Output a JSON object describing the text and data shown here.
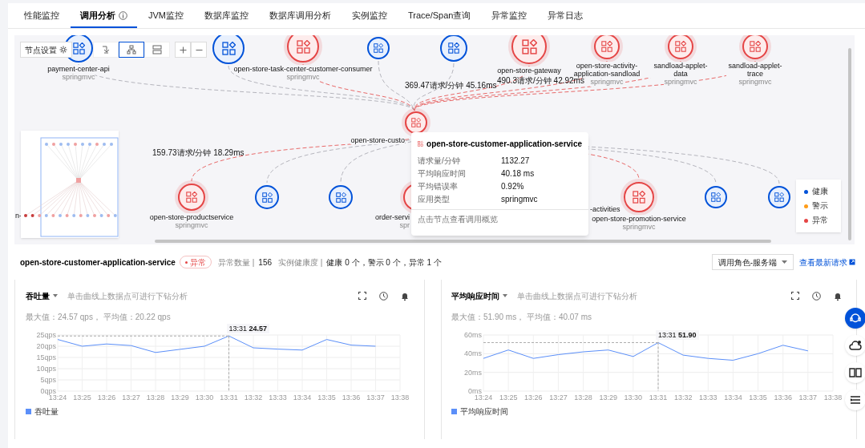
{
  "tabs": [
    {
      "label": "性能监控",
      "selected": false,
      "info": false
    },
    {
      "label": "调用分析",
      "selected": true,
      "info": true
    },
    {
      "label": "JVM监控",
      "selected": false,
      "info": false
    },
    {
      "label": "数据库监控",
      "selected": false,
      "info": false
    },
    {
      "label": "数据库调用分析",
      "selected": false,
      "info": false
    },
    {
      "label": "实例监控",
      "selected": false,
      "info": false
    },
    {
      "label": "Trace/Span查询",
      "selected": false,
      "info": false
    },
    {
      "label": "异常监控",
      "selected": false,
      "info": false
    },
    {
      "label": "异常日志",
      "selected": false,
      "info": false
    }
  ],
  "topology": {
    "toolbar": {
      "settings_label": "节点设置",
      "layouts": [
        {
          "selected": false
        },
        {
          "selected": true
        },
        {
          "selected": false
        }
      ]
    },
    "nodes": [
      {
        "abnormal": false,
        "label": "payment-center-api",
        "sub": "springmvc"
      },
      {
        "abnormal": false
      },
      {
        "abnormal": true,
        "label": "open-store-task-center-customer-consumer",
        "sub": "springmvc"
      },
      {
        "abnormal": false
      },
      {
        "abnormal": false
      },
      {
        "abnormal": true,
        "label": "open-store-gateway"
      },
      {
        "abnormal": true,
        "label": "open-store-activity-application-sandload",
        "sub": "springmvc"
      },
      {
        "abnormal": true,
        "label": "sandload-applet-data",
        "sub": "springmvc"
      },
      {
        "abnormal": true,
        "label": "sandload-applet-trace",
        "sub": "springmvc"
      },
      {
        "abnormal": true,
        "label": "open-store-custo"
      },
      {
        "abnormal": true,
        "label": "open-store-productservice",
        "sub": "springmvc"
      },
      {
        "abnormal": false
      },
      {
        "abnormal": false
      },
      {
        "abnormal": true,
        "label": "order-servi",
        "sub": "spr"
      },
      {
        "abnormal": true,
        "label": "open-store-promotion-service",
        "sub": "springmvc"
      },
      {
        "abnormal": false
      },
      {
        "abnormal": false
      }
    ],
    "edge_labels": [
      "369.47请求/分钟 45.16ms",
      "490.3请求/分钟 42.92ms",
      "159.73请求/分钟 18.29ms"
    ],
    "cut_labels": [
      "n-",
      "-activities"
    ],
    "legend": [
      {
        "label": "健康",
        "color": "#0052d9"
      },
      {
        "label": "警示",
        "color": "#ff9c19"
      },
      {
        "label": "异常",
        "color": "#e54545"
      }
    ],
    "tooltip": {
      "title": "open-store-customer-application-service",
      "rows": [
        {
          "label": "请求量/分钟",
          "value": "1132.27"
        },
        {
          "label": "平均响应时间",
          "value": "40.18 ms"
        },
        {
          "label": "平均错误率",
          "value": "0.92%"
        },
        {
          "label": "应用类型",
          "value": "springmvc"
        }
      ],
      "footer": "点击节点查看调用概览"
    }
  },
  "summary": {
    "title": "open-store-customer-application-service",
    "badge": "异常",
    "stats": [
      {
        "label": "异常数量 |",
        "value": "156"
      },
      {
        "label": "实例健康度 |",
        "value": "健康 0 个，警示 0 个，异常 1 个"
      }
    ],
    "role_select": "调用角色-服务端",
    "link": "查看最新请求"
  },
  "charts": [
    {
      "metric": "吞吐量",
      "hint": "单击曲线上数据点可进行下钻分析",
      "stats": "最大值：24.57 qps， 平均值：20.22 qps",
      "chart_data": {
        "type": "line",
        "grid": true,
        "categories": [
          "13:24",
          "13:25",
          "13:26",
          "13:27",
          "13:28",
          "13:29",
          "13:30",
          "13:31",
          "13:32",
          "13:33",
          "13:34",
          "13:35",
          "13:36",
          "13:37",
          "13:38"
        ],
        "series": [
          {
            "name": "吞吐量",
            "color": "#5b8ff9",
            "values": [
              23,
              20,
              21,
              20.3,
              17.2,
              18.6,
              20,
              24.57,
              19.3,
              18.7,
              18.3,
              23,
              20.5,
              20,
              null
            ]
          }
        ],
        "ylim": [
          0,
          25
        ],
        "yticks": [
          {
            "value": 0,
            "label": "0qps"
          },
          {
            "value": 5,
            "label": "5qps"
          },
          {
            "value": 10,
            "label": "10qps"
          },
          {
            "value": 15,
            "label": "15qps"
          },
          {
            "value": 20,
            "label": "20qps"
          },
          {
            "value": 25,
            "label": "25qps"
          }
        ],
        "ref_lines": [
          {
            "axis": "x",
            "value": "13:31"
          },
          {
            "axis": "y",
            "value": 24.57
          }
        ],
        "annotations": [
          "13:31 **24.57**"
        ]
      }
    },
    {
      "metric": "平均响应时间",
      "hint": "单击曲线上数据点可进行下钻分析",
      "stats": "最大值：51.90 ms， 平均值：40.07 ms",
      "chart_data": {
        "type": "line",
        "grid": true,
        "categories": [
          "13:24",
          "13:25",
          "13:26",
          "13:27",
          "13:28",
          "13:29",
          "13:30",
          "13:31",
          "13:32",
          "13:33",
          "13:34",
          "13:35",
          "13:36",
          "13:37",
          "13:38"
        ],
        "series": [
          {
            "name": "平均响应时间",
            "color": "#5b8ff9",
            "values": [
              35,
              44,
              35,
              39,
              42,
              44,
              37,
              51.9,
              38.5,
              35,
              33,
              40,
              49,
              43,
              null
            ]
          }
        ],
        "ylim": [
          0,
          60
        ],
        "yticks": [
          {
            "value": 0,
            "label": "0ms"
          },
          {
            "value": 20,
            "label": "20ms"
          },
          {
            "value": 40,
            "label": "40ms"
          },
          {
            "value": 60,
            "label": "60ms"
          }
        ],
        "ref_lines": [
          {
            "axis": "x",
            "value": "13:31"
          },
          {
            "axis": "y",
            "value": 51.9
          }
        ],
        "annotations": [
          "13:31 **51.90**"
        ]
      }
    }
  ],
  "side_buttons": [
    {
      "kind": "support",
      "selected": true
    },
    {
      "kind": "cloud",
      "selected": false
    },
    {
      "kind": "book",
      "selected": false
    },
    {
      "kind": "list",
      "selected": false
    }
  ]
}
